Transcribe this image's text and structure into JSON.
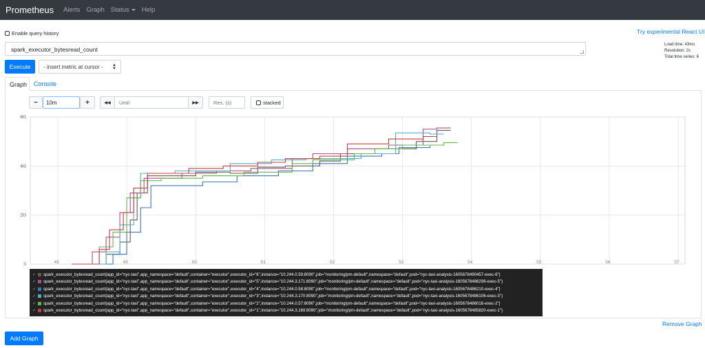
{
  "navbar": {
    "brand": "Prometheus",
    "links": [
      "Alerts",
      "Graph",
      "Status",
      "Help"
    ]
  },
  "query_history_label": "Enable query history",
  "react_ui_link": "Try experimental React UI",
  "expression": "spark_executor_bytesread_count",
  "stats": [
    "Load time: 43ms",
    "Resolution: 2s",
    "Total time series: 6"
  ],
  "execute_label": "Execute",
  "metric_select": "- insert metric at cursor -",
  "tabs": {
    "graph": "Graph",
    "console": "Console"
  },
  "controls": {
    "minus": "−",
    "range": "10m",
    "plus": "+",
    "back": "◀◀",
    "until_placeholder": "Until",
    "forward": "▶▶",
    "res_placeholder": "Res. (s)",
    "stacked": "stacked"
  },
  "remove_graph": "Remove Graph",
  "add_graph": "Add Graph",
  "chart_data": {
    "type": "line",
    "y_ticks": [
      "6G",
      "4G",
      "2G",
      "0"
    ],
    "x_ticks": [
      "48",
      "49",
      "50",
      "51",
      "52",
      "53",
      "54",
      "55",
      "56",
      "57"
    ],
    "ylim": [
      0,
      6
    ],
    "xlim": [
      47.6,
      57.1
    ],
    "grid": true,
    "series": [
      {
        "name": "exec-6",
        "color": "#6a5a4a",
        "points": [
          [
            48.2,
            0
          ],
          [
            48.7,
            0
          ],
          [
            48.7,
            0.4
          ],
          [
            48.9,
            0.4
          ],
          [
            48.9,
            0.9
          ],
          [
            49.05,
            0.9
          ],
          [
            49.05,
            1.8
          ],
          [
            49.15,
            1.8
          ],
          [
            49.15,
            2.9
          ],
          [
            49.3,
            2.9
          ],
          [
            49.3,
            3.6
          ],
          [
            50.0,
            3.6
          ],
          [
            50.0,
            3.75
          ],
          [
            50.5,
            3.75
          ],
          [
            50.5,
            3.7
          ],
          [
            50.9,
            3.7
          ],
          [
            50.9,
            3.95
          ],
          [
            51.3,
            3.95
          ],
          [
            51.3,
            4.0
          ],
          [
            51.8,
            4.0
          ],
          [
            51.8,
            4.2
          ],
          [
            52.1,
            4.2
          ],
          [
            52.1,
            4.5
          ],
          [
            52.6,
            4.5
          ],
          [
            52.6,
            4.7
          ],
          [
            53.2,
            4.7
          ],
          [
            53.2,
            5.0
          ],
          [
            53.5,
            5.0
          ],
          [
            53.5,
            5.45
          ],
          [
            53.7,
            5.45
          ]
        ]
      },
      {
        "name": "exec-5",
        "color": "#a64d8e",
        "points": [
          [
            48.2,
            0
          ],
          [
            48.5,
            0
          ],
          [
            48.5,
            0.5
          ],
          [
            48.7,
            0.5
          ],
          [
            48.7,
            1.1
          ],
          [
            48.9,
            1.1
          ],
          [
            48.9,
            2.1
          ],
          [
            49.05,
            2.1
          ],
          [
            49.05,
            2.9
          ],
          [
            49.25,
            2.9
          ],
          [
            49.25,
            3.5
          ],
          [
            49.8,
            3.5
          ],
          [
            49.8,
            3.7
          ],
          [
            50.3,
            3.7
          ],
          [
            50.3,
            3.8
          ],
          [
            50.8,
            3.8
          ],
          [
            50.8,
            3.9
          ],
          [
            51.4,
            3.9
          ],
          [
            51.4,
            4.3
          ],
          [
            51.7,
            4.3
          ],
          [
            51.7,
            4.5
          ],
          [
            52.2,
            4.5
          ],
          [
            52.2,
            4.7
          ],
          [
            52.8,
            4.7
          ],
          [
            52.8,
            4.85
          ],
          [
            53.3,
            4.85
          ],
          [
            53.3,
            5.5
          ],
          [
            53.5,
            5.5
          ],
          [
            53.5,
            5.55
          ],
          [
            53.7,
            5.55
          ]
        ]
      },
      {
        "name": "exec-4",
        "color": "#3a76b8",
        "points": [
          [
            48.3,
            0
          ],
          [
            48.8,
            0
          ],
          [
            48.8,
            0.4
          ],
          [
            49.0,
            0.4
          ],
          [
            49.0,
            1.3
          ],
          [
            49.2,
            1.3
          ],
          [
            49.2,
            2.3
          ],
          [
            49.35,
            2.3
          ],
          [
            49.35,
            3.2
          ],
          [
            50.1,
            3.2
          ],
          [
            50.1,
            3.35
          ],
          [
            50.6,
            3.35
          ],
          [
            50.6,
            3.6
          ],
          [
            51.2,
            3.6
          ],
          [
            51.2,
            3.8
          ],
          [
            51.7,
            3.8
          ],
          [
            51.7,
            4.1
          ],
          [
            52.2,
            4.1
          ],
          [
            52.2,
            4.4
          ],
          [
            52.7,
            4.4
          ],
          [
            52.7,
            4.5
          ],
          [
            52.95,
            4.5
          ],
          [
            52.95,
            4.75
          ],
          [
            53.4,
            4.75
          ],
          [
            53.4,
            4.85
          ],
          [
            53.5,
            4.85
          ]
        ]
      },
      {
        "name": "exec-3",
        "color": "#4fb0c6",
        "points": [
          [
            48.3,
            0
          ],
          [
            48.7,
            0
          ],
          [
            48.7,
            0.5
          ],
          [
            48.9,
            0.5
          ],
          [
            48.9,
            1.6
          ],
          [
            49.1,
            1.6
          ],
          [
            49.1,
            2.7
          ],
          [
            49.2,
            2.7
          ],
          [
            49.2,
            3.7
          ],
          [
            49.7,
            3.7
          ],
          [
            49.7,
            3.8
          ],
          [
            50.5,
            3.8
          ],
          [
            50.5,
            4.1
          ],
          [
            51.1,
            4.1
          ],
          [
            51.1,
            4.25
          ],
          [
            51.6,
            4.25
          ],
          [
            51.6,
            4.3
          ],
          [
            52.4,
            4.3
          ],
          [
            52.4,
            4.5
          ],
          [
            52.9,
            4.5
          ],
          [
            52.9,
            5.35
          ],
          [
            53.4,
            5.35
          ],
          [
            53.4,
            5.3
          ],
          [
            53.6,
            5.3
          ]
        ]
      },
      {
        "name": "exec-2",
        "color": "#63b548",
        "points": [
          [
            48.4,
            0
          ],
          [
            48.6,
            0
          ],
          [
            48.6,
            0.7
          ],
          [
            48.8,
            0.7
          ],
          [
            48.8,
            1.3
          ],
          [
            49.0,
            1.3
          ],
          [
            49.0,
            2.7
          ],
          [
            49.2,
            2.7
          ],
          [
            49.2,
            3.4
          ],
          [
            49.5,
            3.4
          ],
          [
            49.5,
            3.5
          ],
          [
            50.1,
            3.5
          ],
          [
            50.1,
            3.6
          ],
          [
            50.7,
            3.6
          ],
          [
            50.7,
            3.75
          ],
          [
            51.4,
            3.75
          ],
          [
            51.4,
            4.1
          ],
          [
            51.7,
            4.1
          ],
          [
            51.7,
            4.25
          ],
          [
            52.3,
            4.25
          ],
          [
            52.3,
            4.5
          ],
          [
            52.6,
            4.5
          ],
          [
            52.6,
            4.7
          ],
          [
            53.0,
            4.7
          ],
          [
            53.0,
            4.85
          ],
          [
            53.6,
            4.85
          ],
          [
            53.6,
            4.95
          ],
          [
            53.8,
            4.95
          ]
        ]
      },
      {
        "name": "exec-1",
        "color": "#c73c3c",
        "points": [
          [
            48.2,
            0
          ],
          [
            48.6,
            0
          ],
          [
            48.6,
            0.6
          ],
          [
            48.75,
            0.6
          ],
          [
            48.75,
            1.4
          ],
          [
            48.95,
            1.4
          ],
          [
            48.95,
            2.1
          ],
          [
            49.1,
            2.1
          ],
          [
            49.1,
            3.1
          ],
          [
            49.3,
            3.1
          ],
          [
            49.3,
            3.7
          ],
          [
            49.9,
            3.7
          ],
          [
            49.9,
            3.9
          ],
          [
            50.4,
            3.9
          ],
          [
            50.4,
            4.0
          ],
          [
            50.9,
            4.0
          ],
          [
            50.9,
            4.15
          ],
          [
            51.3,
            4.15
          ],
          [
            51.3,
            4.3
          ],
          [
            51.8,
            4.3
          ],
          [
            51.8,
            4.4
          ],
          [
            52.2,
            4.4
          ],
          [
            52.2,
            4.9
          ],
          [
            52.8,
            4.9
          ],
          [
            52.8,
            5.1
          ],
          [
            53.3,
            5.1
          ],
          [
            53.3,
            5.2
          ],
          [
            53.5,
            5.2
          ]
        ]
      }
    ]
  },
  "legend": [
    {
      "color": "#6a5a4a",
      "label": "spark_executor_bytesread_count{app_id=\"nyc-taxi\",app_namespace=\"default\",container=\"executor\",executor_id=\"6\",instance=\"10.244.0.59:8090\",job=\"monitoring/pm-default\",namespace=\"default\",pod=\"nyc-taxi-analysis-1605678490457-exec-6\"}"
    },
    {
      "color": "#a64d8e",
      "label": "spark_executor_bytesread_count{app_id=\"nyc-taxi\",app_namespace=\"default\",container=\"executor\",executor_id=\"5\",instance=\"10.244.3.171:8090\",job=\"monitoring/pm-default\",namespace=\"default\",pod=\"nyc-taxi-analysis-1605678486298-exec-5\"}"
    },
    {
      "color": "#3a76b8",
      "label": "spark_executor_bytesread_count{app_id=\"nyc-taxi\",app_namespace=\"default\",container=\"executor\",executor_id=\"4\",instance=\"10.244.0.58:8090\",job=\"monitoring/pm-default\",namespace=\"default\",pod=\"nyc-taxi-analysis-1605678486210-exec-4\"}"
    },
    {
      "color": "#4fb0c6",
      "label": "spark_executor_bytesread_count{app_id=\"nyc-taxi\",app_namespace=\"default\",container=\"executor\",executor_id=\"3\",instance=\"10.244.3.170:8090\",job=\"monitoring/pm-default\",namespace=\"default\",pod=\"nyc-taxi-analysis-1605678486106-exec-3\"}"
    },
    {
      "color": "#63b548",
      "label": "spark_executor_bytesread_count{app_id=\"nyc-taxi\",app_namespace=\"default\",container=\"executor\",executor_id=\"2\",instance=\"10.244.0.57:8090\",job=\"monitoring/pm-default\",namespace=\"default\",pod=\"nyc-taxi-analysis-1605678486018-exec-2\"}"
    },
    {
      "color": "#c73c3c",
      "label": "spark_executor_bytesread_count{app_id=\"nyc-taxi\",app_namespace=\"default\",container=\"executor\",executor_id=\"1\",instance=\"10.244.3.169:8090\",job=\"monitoring/pm-default\",namespace=\"default\",pod=\"nyc-taxi-analysis-1605678485820-exec-1\"}"
    }
  ]
}
